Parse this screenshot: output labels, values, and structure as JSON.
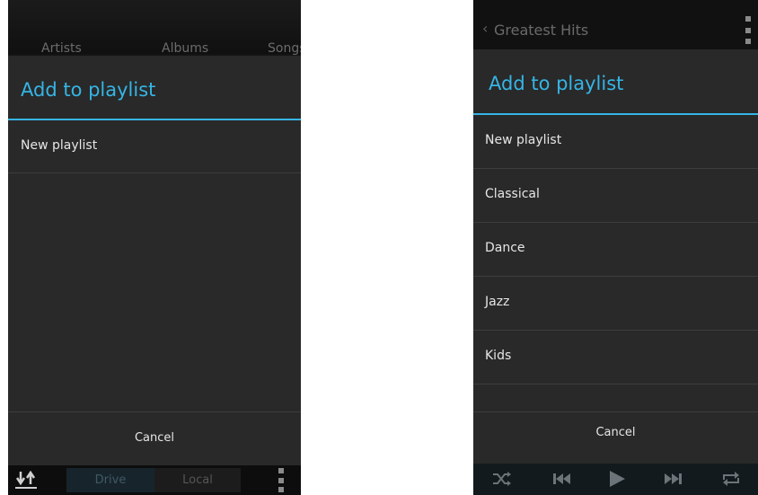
{
  "left_screen": {
    "tabs": [
      "Artists",
      "Albums",
      "Songs"
    ],
    "dialog": {
      "title": "Add to playlist",
      "items": [
        {
          "label": "New playlist"
        }
      ],
      "cancel_label": "Cancel"
    },
    "bottom_bar": {
      "icon": "sort-icon",
      "drive_label": "Drive",
      "local_label": "Local",
      "menu_icon": "overflow-menu-icon"
    }
  },
  "right_screen": {
    "title_bar": {
      "back_icon": "back-chevron-icon",
      "title": "Greatest Hits",
      "menu_icon": "overflow-menu-icon"
    },
    "dialog": {
      "title": "Add to playlist",
      "items": [
        {
          "label": "New playlist"
        },
        {
          "label": "Classical"
        },
        {
          "label": "Dance"
        },
        {
          "label": "Jazz"
        },
        {
          "label": "Kids"
        }
      ],
      "cancel_label": "Cancel"
    },
    "player_bar": {
      "icons": [
        "shuffle-icon",
        "previous-icon",
        "play-icon",
        "next-icon",
        "repeat-icon"
      ]
    }
  },
  "colors": {
    "accent": "#35b5e5",
    "dialog_bg": "#292929",
    "divider": "#3d3d3d",
    "text": "#e6e6e6"
  }
}
